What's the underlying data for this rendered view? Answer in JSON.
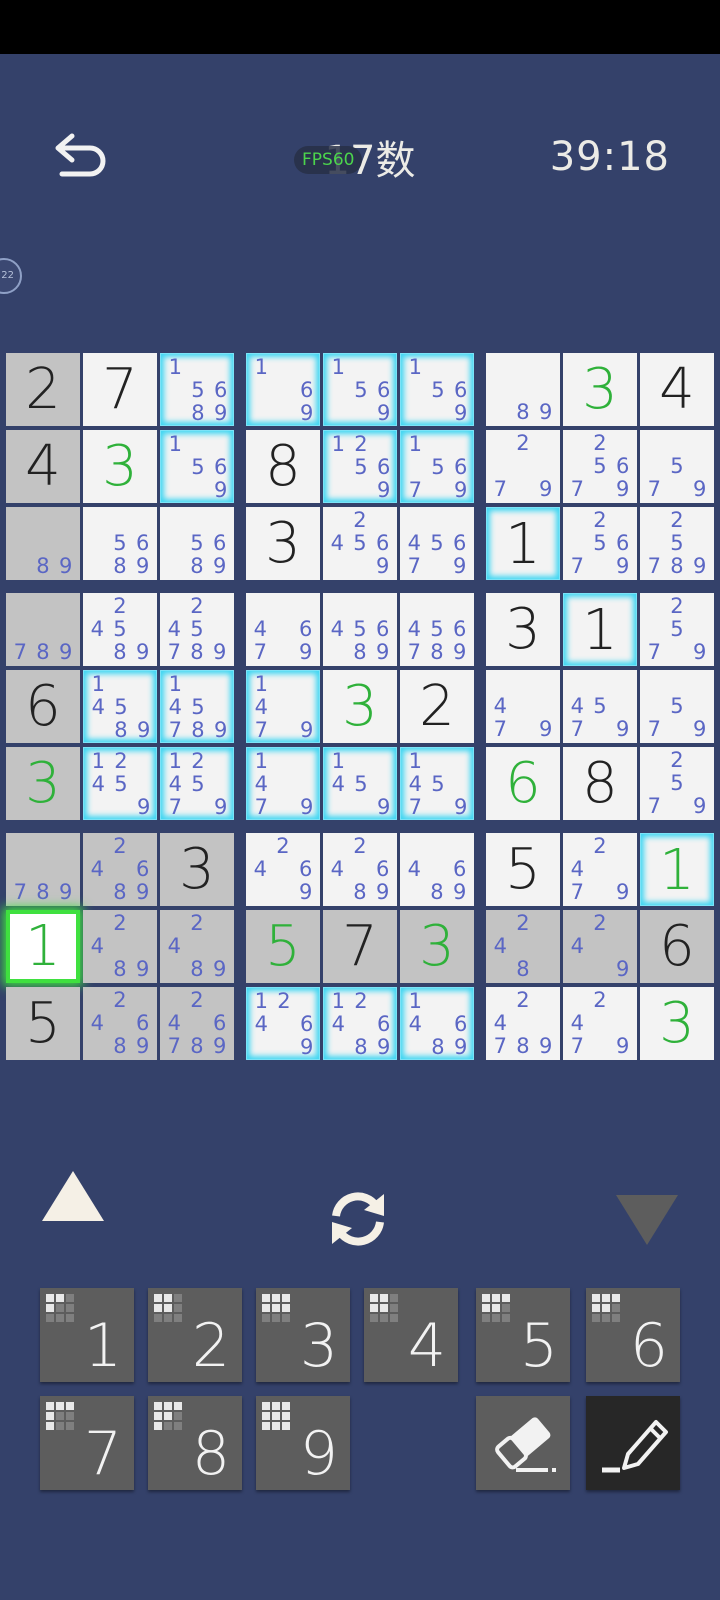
{
  "header": {
    "title": "17数",
    "fps_label": "FPS60",
    "timer": "39:18",
    "side_badge": "22"
  },
  "colors": {
    "background": "#34416a",
    "given_digit": "#222222",
    "placed_digit": "#2fb13a",
    "candidate": "#5a66c4",
    "highlight_glow": "#3fd6f2",
    "selection": "#3fe03f"
  },
  "board": {
    "rows": [
      [
        {
          "v": "2",
          "given": true,
          "shade": "grey"
        },
        {
          "v": "7",
          "given": true
        },
        {
          "c": "1 56 89",
          "glow": true
        },
        {
          "c": "1 6 9",
          "glow": true
        },
        {
          "c": "1 56 9",
          "glow": true
        },
        {
          "c": "1 56 9",
          "glow": true
        },
        {
          "c": " 89"
        },
        {
          "v": "3",
          "placed": true
        },
        {
          "v": "4",
          "given": true
        }
      ],
      [
        {
          "v": "4",
          "given": true,
          "shade": "grey"
        },
        {
          "v": "3",
          "placed": true
        },
        {
          "c": "1 56 9",
          "glow": true
        },
        {
          "v": "8",
          "given": true
        },
        {
          "c": "12 56 9",
          "glow": true
        },
        {
          "c": "1 56 79",
          "glow": true
        },
        {
          "c": "2 79"
        },
        {
          "c": "2 56 79"
        },
        {
          "c": "5 79"
        }
      ],
      [
        {
          "c": " 89",
          "shade": "grey"
        },
        {
          "c": "56 89"
        },
        {
          "c": "56 89"
        },
        {
          "v": "3",
          "given": true
        },
        {
          "c": "2 456 9"
        },
        {
          "c": "456 79"
        },
        {
          "v": "1",
          "given": true,
          "glow": true
        },
        {
          "c": "2 56 79"
        },
        {
          "c": "2 5 789"
        }
      ],
      [
        {
          "c": "789",
          "shade": "grey"
        },
        {
          "c": "2 45 89"
        },
        {
          "c": "2 45 789"
        },
        {
          "c": "4 6 79"
        },
        {
          "c": "456 89"
        },
        {
          "c": "456 789"
        },
        {
          "v": "3",
          "given": true
        },
        {
          "v": "1",
          "given": true,
          "glow": true
        },
        {
          "c": "2 5 79"
        }
      ],
      [
        {
          "v": "6",
          "given": true,
          "shade": "grey"
        },
        {
          "c": "1 45 89",
          "glow": true
        },
        {
          "c": "1 45 789",
          "glow": true
        },
        {
          "c": "1 4 79",
          "glow": true
        },
        {
          "v": "3",
          "placed": true
        },
        {
          "v": "2",
          "given": true
        },
        {
          "c": "4 79"
        },
        {
          "c": "45 79"
        },
        {
          "c": "5 79"
        }
      ],
      [
        {
          "v": "3",
          "placed": true,
          "shade": "grey"
        },
        {
          "c": "12 45 9",
          "glow": true
        },
        {
          "c": "12 45 79",
          "glow": true
        },
        {
          "c": "1 4 79",
          "glow": true
        },
        {
          "c": "1 45 9",
          "glow": true
        },
        {
          "c": "1 45 79",
          "glow": true
        },
        {
          "v": "6",
          "placed": true
        },
        {
          "v": "8",
          "given": true
        },
        {
          "c": "2 5 79"
        }
      ],
      [
        {
          "c": "789",
          "shade": "grey"
        },
        {
          "c": "2 4 6 89",
          "shade": "grey"
        },
        {
          "v": "3",
          "given": true,
          "shade": "grey"
        },
        {
          "c": "2 4 6 9"
        },
        {
          "c": "2 4 6 89"
        },
        {
          "c": "4 6 89"
        },
        {
          "v": "5",
          "given": true
        },
        {
          "c": "2 4 79"
        },
        {
          "v": "1",
          "placed": true,
          "glow": true
        }
      ],
      [
        {
          "v": "1",
          "placed": true,
          "selected": true
        },
        {
          "c": "2 4 89",
          "shade": "grey"
        },
        {
          "c": "2 4 89",
          "shade": "grey"
        },
        {
          "v": "5",
          "placed": true,
          "shade": "grey"
        },
        {
          "v": "7",
          "given": true,
          "shade": "grey"
        },
        {
          "v": "3",
          "placed": true,
          "shade": "grey"
        },
        {
          "c": "2 4 8",
          "shade": "grey"
        },
        {
          "c": "2 4 9",
          "shade": "grey"
        },
        {
          "v": "6",
          "given": true,
          "shade": "grey"
        }
      ],
      [
        {
          "v": "5",
          "given": true,
          "shade": "grey"
        },
        {
          "c": "2 4 6 89",
          "shade": "grey"
        },
        {
          "c": "2 4 6 789",
          "shade": "grey"
        },
        {
          "c": "12 4 6 9",
          "glow": true
        },
        {
          "c": "12 4 6 89",
          "glow": true
        },
        {
          "c": "1 4 6 89",
          "glow": true
        },
        {
          "c": "2 4 789"
        },
        {
          "c": "2 4 79"
        },
        {
          "v": "3",
          "placed": true
        }
      ]
    ]
  },
  "controls": {
    "up_icon": "triangle-up-icon",
    "rotate_icon": "rotate-arrows-icon",
    "down_icon": "triangle-down-icon"
  },
  "numpad": {
    "keys": [
      {
        "label": "1",
        "pattern": [
          1,
          1,
          0,
          1,
          0,
          0,
          0,
          0,
          0
        ]
      },
      {
        "label": "2",
        "pattern": [
          1,
          1,
          0,
          1,
          1,
          0,
          0,
          0,
          0
        ]
      },
      {
        "label": "3",
        "pattern": [
          1,
          1,
          1,
          1,
          1,
          1,
          0,
          0,
          0
        ]
      },
      {
        "label": "4",
        "pattern": [
          1,
          1,
          0,
          1,
          1,
          0,
          0,
          0,
          0
        ]
      },
      {
        "label": "5",
        "pattern": [
          1,
          1,
          1,
          1,
          1,
          0,
          0,
          0,
          0
        ]
      },
      {
        "label": "6",
        "pattern": [
          1,
          1,
          1,
          1,
          1,
          0,
          0,
          0,
          0
        ]
      },
      {
        "label": "7",
        "pattern": [
          1,
          1,
          1,
          1,
          0,
          0,
          1,
          0,
          0
        ]
      },
      {
        "label": "8",
        "pattern": [
          1,
          1,
          1,
          1,
          1,
          0,
          1,
          0,
          0
        ]
      },
      {
        "label": "9",
        "pattern": [
          1,
          1,
          1,
          1,
          1,
          1,
          1,
          1,
          1
        ]
      }
    ],
    "eraser_icon": "eraser-icon",
    "pencil_icon": "pencil-icon"
  }
}
